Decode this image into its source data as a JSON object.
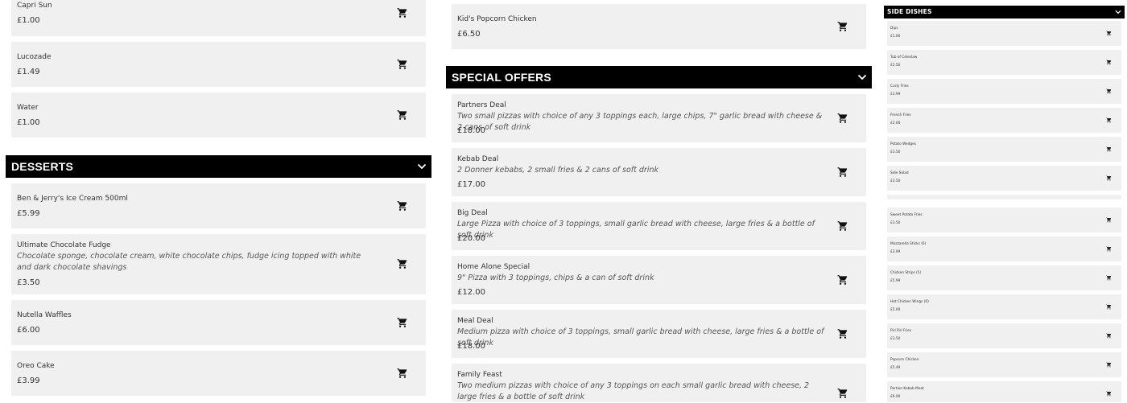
{
  "left_column": {
    "drinks_items": [
      {
        "name": "Capri Sun",
        "price": "£1.00"
      },
      {
        "name": "Lucozade",
        "price": "£1.49"
      },
      {
        "name": "Water",
        "price": "£1.00"
      }
    ],
    "desserts": {
      "title": "DESSERTS",
      "items": [
        {
          "name": "Ben & Jerry's Ice Cream 500ml",
          "price": "£5.99"
        },
        {
          "name": "Ultimate Chocolate Fudge",
          "description": "Chocolate sponge, chocolate cream, white chocolate chips, fudge icing topped with white and dark chocolate shavings",
          "price": "£3.50"
        },
        {
          "name": "Nutella Waffles",
          "price": "£6.00"
        },
        {
          "name": "Oreo Cake",
          "price": "£3.99"
        }
      ]
    }
  },
  "middle_column": {
    "top_item": {
      "name": "Kid's Popcorn Chicken",
      "price": "£6.50"
    },
    "special_offers": {
      "title": "SPECIAL OFFERS",
      "items": [
        {
          "name": "Partners Deal",
          "description": "Two small pizzas with choice of any 3 toppings each, large chips, 7\" garlic bread with cheese & 2 cans of soft drink",
          "price": "£18.00"
        },
        {
          "name": "Kebab Deal",
          "description": "2 Donner kebabs, 2 small fries & 2 cans of soft drink",
          "price": "£17.00"
        },
        {
          "name": "Big Deal",
          "description": "Large Pizza with choice of 3 toppings, small garlic bread with cheese, large fries & a bottle of soft drink",
          "price": "£20.00"
        },
        {
          "name": "Home Alone Special",
          "description": "9\" Pizza with 3 toppings, chips & a can of soft drink",
          "price": "£12.00"
        },
        {
          "name": "Meal Deal",
          "description": "Medium pizza with choice of 3 toppings, small garlic bread with cheese, large fries & a bottle of soft drink",
          "price": "£18.00"
        },
        {
          "name": "Family Feast",
          "description": "Two medium pizzas with choice of any 3 toppings on each small garlic bread with cheese, 2 large fries & a bottle of soft drink",
          "price": ""
        }
      ]
    }
  },
  "right_column": {
    "side_dishes": {
      "title": "SIDE DISHES",
      "items": [
        {
          "name": "Dips",
          "price": "£1.00"
        },
        {
          "name": "Tub of Coleslaw",
          "price": "£2.50"
        },
        {
          "name": "Curly Fries",
          "price": "£3.99"
        },
        {
          "name": "French Fries",
          "price": "£2.00"
        },
        {
          "name": "Potato Wedges",
          "price": "£3.50"
        },
        {
          "name": "Side Salad",
          "price": "£3.50"
        }
      ],
      "items_lower": [
        {
          "name": "Sweet Potato Fries",
          "price": "£3.50"
        },
        {
          "name": "Mozzarella Sticks (6)",
          "price": "£3.99"
        },
        {
          "name": "Chicken Strips (5)",
          "price": "£5.99"
        },
        {
          "name": "Hot Chicken Wings (6)",
          "price": "£5.00"
        },
        {
          "name": "Piri Piri Fries",
          "price": "£3.50"
        },
        {
          "name": "Popcorn Chicken",
          "price": "£5.49"
        },
        {
          "name": "Portion Kebab Meat",
          "price": "£6.00"
        }
      ]
    }
  },
  "icons": {
    "cart": "cart-icon",
    "collapse": "chevron-down-icon"
  },
  "colors": {
    "header_bg": "#000000",
    "card_bg": "#f0f0f0",
    "text": "#333333"
  }
}
